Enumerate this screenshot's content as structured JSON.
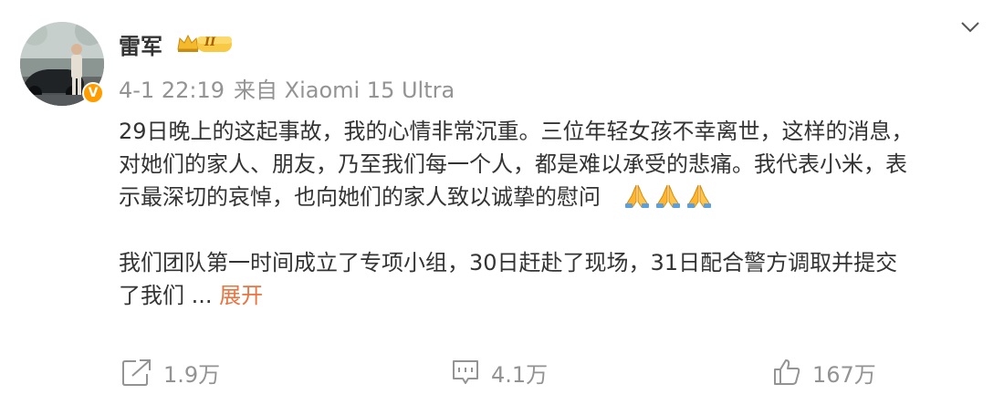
{
  "user": {
    "name": "雷军",
    "level_badge": "II",
    "verified": true,
    "verified_mark": "V"
  },
  "post": {
    "time": "4-1 22:19",
    "source": "来自 Xiaomi 15 Ultra",
    "lines": [
      "29日晚上的这起事故，我的心情非常沉重。三位年轻女孩不幸离世，这样的消息，",
      "对她们的家人、朋友，乃至我们每一个人，都是难以承受的悲痛。我代表小米，表",
      "示最深切的哀悼，也向她们的家人致以诚挚的慰问",
      "我们团队第一时间成立了专项小组，30日赶赴了现场，31日配合警方调取并提交",
      "了我们 "
    ],
    "emoji": [
      "praying-hands-icon",
      "praying-hands-icon",
      "praying-hands-icon"
    ],
    "ellipsis": "...",
    "expand_label": "展开"
  },
  "actions": {
    "repost_count": "1.9万",
    "comment_count": "4.1万",
    "like_count": "167万"
  },
  "colors": {
    "text": "#333333",
    "meta": "#939393",
    "link": "#eb7340",
    "verified": "#ff9c00",
    "emoji": "#ffb62e"
  }
}
